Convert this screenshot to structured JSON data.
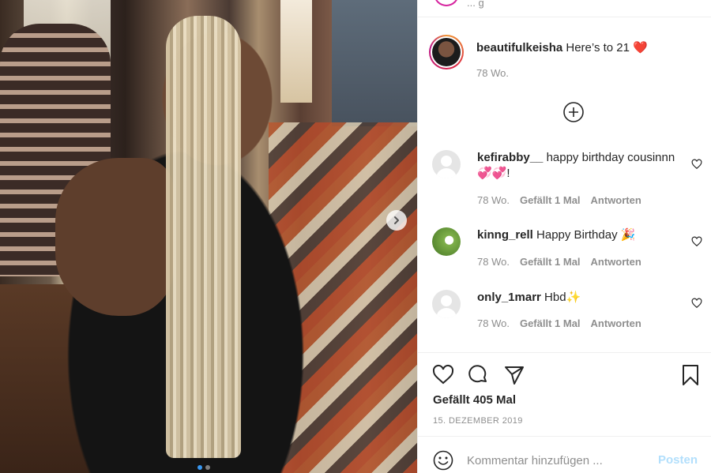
{
  "post": {
    "image_alt": "",
    "carousel": {
      "count": 2,
      "active_index": 0
    }
  },
  "topbar": {
    "partial_text": "... g"
  },
  "caption": {
    "username": "beautifulkeisha",
    "text": "Here’s to 21 ❤️",
    "time": "78 Wo."
  },
  "comments": [
    {
      "username": "kefirabby__",
      "text": "happy birthday cousinnn💞💞!",
      "time": "78 Wo.",
      "likes": "Gefällt 1 Mal",
      "reply": "Antworten",
      "avatar": "default"
    },
    {
      "username": "kinng_rell",
      "text": "Happy Birthday 🎉",
      "time": "78 Wo.",
      "likes": "Gefällt 1 Mal",
      "reply": "Antworten",
      "avatar": "photo"
    },
    {
      "username": "only_1marr",
      "text": "Hbd✨",
      "time": "78 Wo.",
      "likes": "Gefällt 1 Mal",
      "reply": "Antworten",
      "avatar": "default"
    }
  ],
  "stats": {
    "likes": "Gefällt 405 Mal",
    "date": "15. Dezember 2019"
  },
  "compose": {
    "placeholder": "Kommentar hinzufügen ...",
    "post_label": "Posten"
  },
  "icons": {
    "next": "chevron-right-icon",
    "load_more": "plus-circle-icon",
    "like": "heart-icon",
    "comment": "comment-bubble-icon",
    "share": "paper-plane-icon",
    "save": "bookmark-icon",
    "emoji": "smiley-icon"
  },
  "colors": {
    "accent": "#3897f0",
    "post_disabled": "#b2dffc",
    "secondary_text": "#8e8e8e",
    "primary_text": "#262626"
  }
}
